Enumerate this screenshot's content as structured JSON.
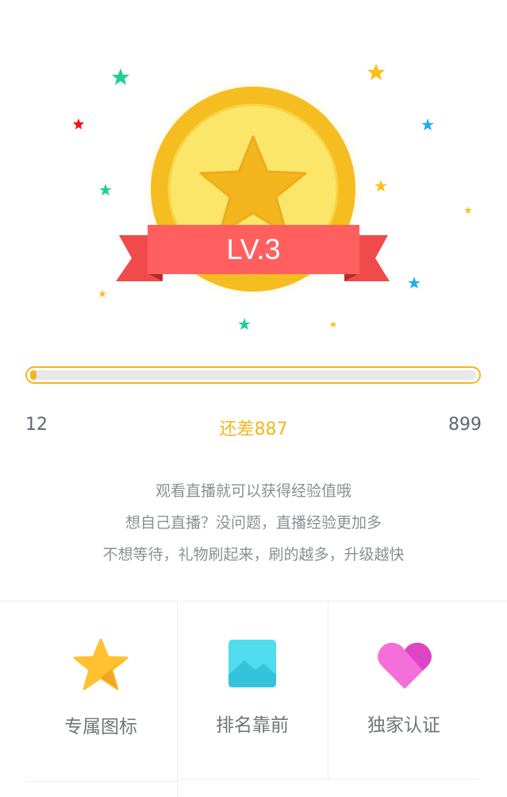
{
  "level": {
    "label": "LV.3",
    "current_exp": "12",
    "remaining_text": "还差887",
    "next_exp": "899",
    "progress_fraction": 0.013
  },
  "description": {
    "line1": "观看直播就可以获得经验值哦",
    "line2": "想自己直播？没问题，直播经验更加多",
    "line3": "不想等待，礼物刷起来，刷的越多，升级越快"
  },
  "perks": [
    {
      "label": "专属图标",
      "icon": "star-icon"
    },
    {
      "label": "排名靠前",
      "icon": "picture-icon"
    },
    {
      "label": "独家认证",
      "icon": "heart-icon"
    }
  ],
  "colors": {
    "accent": "#f3b61f",
    "ribbon": "#ff5f5f",
    "coin_outer": "#f5bd1f",
    "coin_inner": "#fbe66a"
  }
}
